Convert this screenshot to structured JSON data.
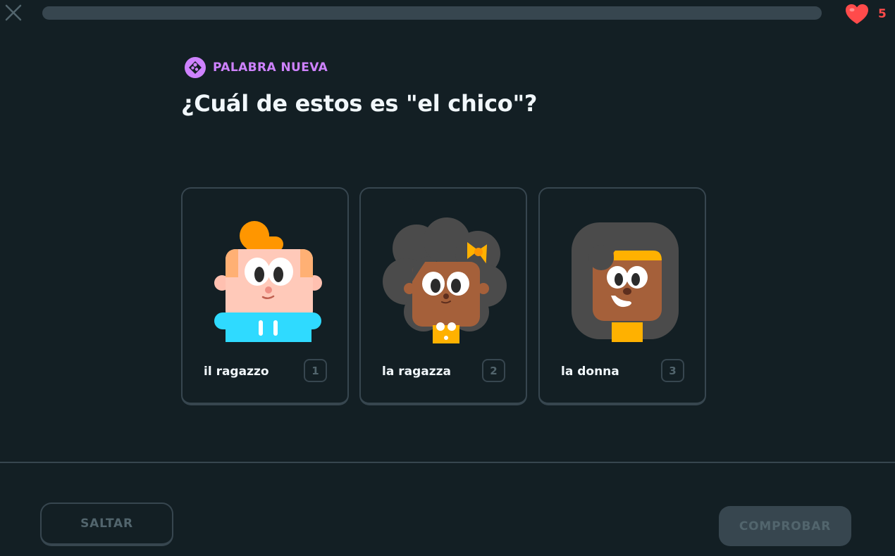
{
  "header": {
    "progress": 0,
    "hearts": "5"
  },
  "exercise": {
    "badge_label": "PALABRA NUEVA",
    "prompt": "¿Cuál de estos es \"el chico\"?"
  },
  "choices": [
    {
      "label": "il ragazzo",
      "key": "1",
      "icon": "boy-avatar"
    },
    {
      "label": "la ragazza",
      "key": "2",
      "icon": "girl-avatar"
    },
    {
      "label": "la donna",
      "key": "3",
      "icon": "woman-avatar"
    }
  ],
  "footer": {
    "skip_label": "SALTAR",
    "check_label": "COMPROBAR"
  },
  "colors": {
    "background": "#131f24",
    "border": "#37464f",
    "accent_purple": "#ce82ff",
    "heart_red": "#ff4b4b",
    "muted_text": "#52656d"
  }
}
